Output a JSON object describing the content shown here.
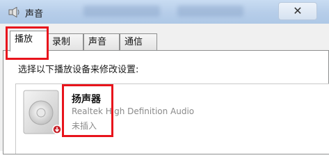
{
  "window": {
    "title": "声音",
    "close_glyph": "✕",
    "title_icon": "speaker-icon"
  },
  "tabs": [
    {
      "label": "播放",
      "active": true
    },
    {
      "label": "录制",
      "active": false
    },
    {
      "label": "声音",
      "active": false
    },
    {
      "label": "通信",
      "active": false
    }
  ],
  "playback": {
    "instruction": "选择以下播放设备来修改设置:",
    "device": {
      "name": "扬声器",
      "description": "Realtek High Definition Audio",
      "status": "未插入",
      "icon": "speaker-device-icon",
      "status_icon": "unplugged-badge-icon"
    }
  },
  "colors": {
    "highlight": "#e8141c",
    "titlebar": "#b6cde9",
    "status_badge": "#c8222a"
  }
}
